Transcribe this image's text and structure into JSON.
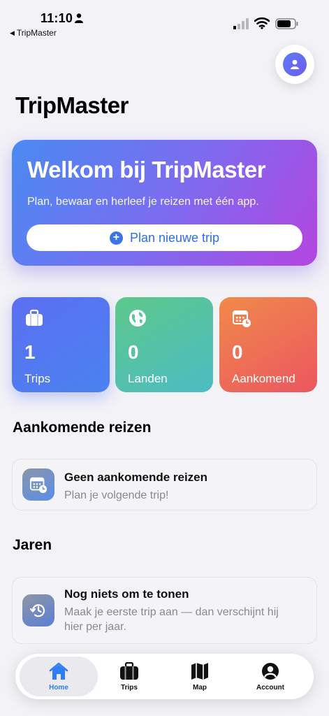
{
  "status_bar": {
    "time": "11:10",
    "back_label": "TripMaster"
  },
  "page": {
    "title": "TripMaster"
  },
  "hero": {
    "title": "Welkom bij TripMaster",
    "subtitle": "Plan, bewaar en herleef je reizen met één app.",
    "button_label": "Plan nieuwe trip"
  },
  "stats": [
    {
      "value": "1",
      "label": "Trips",
      "icon": "suitcase-icon"
    },
    {
      "value": "0",
      "label": "Landen",
      "icon": "globe-icon"
    },
    {
      "value": "0",
      "label": "Aankomend",
      "icon": "calendar-clock-icon"
    }
  ],
  "upcoming": {
    "heading": "Aankomende reizen",
    "empty_title": "Geen aankomende reizen",
    "empty_subtitle": "Plan je volgende trip!"
  },
  "years": {
    "heading": "Jaren",
    "empty_title": "Nog niets om te tonen",
    "empty_subtitle": "Maak je eerste trip aan — dan verschijnt hij hier per jaar."
  },
  "tabbar": {
    "items": [
      {
        "label": "Home",
        "icon": "house-icon",
        "active": true
      },
      {
        "label": "Trips",
        "icon": "suitcase-icon",
        "active": false
      },
      {
        "label": "Map",
        "icon": "map-icon",
        "active": false
      },
      {
        "label": "Account",
        "icon": "account-icon",
        "active": false
      }
    ]
  },
  "colors": {
    "accent": "#2f7df6",
    "hero_start": "#4a8af3",
    "hero_end": "#b445e0",
    "trips_card": "#5b6ff2",
    "landen_card": "#5dc88a",
    "aankomend_card": "#ec5660",
    "background": "#f2f2f7"
  }
}
